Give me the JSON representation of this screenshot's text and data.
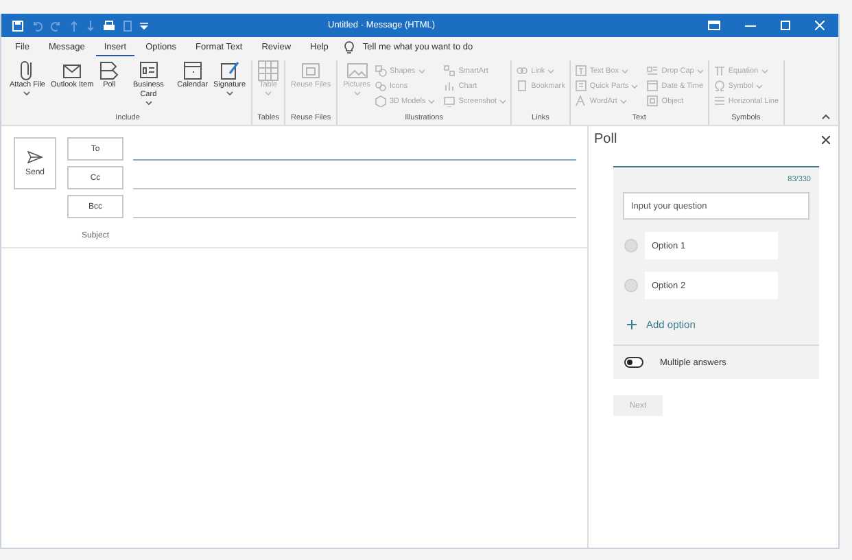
{
  "window": {
    "title": "Untitled  -  Message (HTML)"
  },
  "menu_tabs": [
    {
      "label": "File",
      "selected": false
    },
    {
      "label": "Message",
      "selected": false
    },
    {
      "label": "Insert",
      "selected": true
    },
    {
      "label": "Options",
      "selected": false
    },
    {
      "label": "Format Text",
      "selected": false
    },
    {
      "label": "Review",
      "selected": false
    },
    {
      "label": "Help",
      "selected": false
    }
  ],
  "tell_me": "Tell me what you want to do",
  "ribbon_groups": [
    {
      "label": "Include",
      "items": [
        {
          "kind": "large",
          "label": "Attach File",
          "dropdown": true,
          "disabled": false
        },
        {
          "kind": "large",
          "label": "Outlook Item",
          "dropdown": false,
          "disabled": false
        },
        {
          "kind": "large",
          "label": "Poll",
          "dropdown": false,
          "disabled": false
        },
        {
          "kind": "large",
          "label": "Business Card",
          "dropdown": true,
          "disabled": false
        },
        {
          "kind": "large",
          "label": "Calendar",
          "dropdown": false,
          "disabled": false
        },
        {
          "kind": "large",
          "label": "Signature",
          "dropdown": true,
          "disabled": false
        }
      ]
    },
    {
      "label": "Tables",
      "items": [
        {
          "kind": "large",
          "label": "Table",
          "dropdown": true,
          "disabled": true
        }
      ]
    },
    {
      "label": "Reuse Files",
      "items": [
        {
          "kind": "large",
          "label": "Reuse Files",
          "dropdown": false,
          "disabled": true
        }
      ]
    },
    {
      "label": "Illustrations",
      "items": [
        {
          "kind": "large",
          "label": "Pictures",
          "dropdown": true,
          "disabled": true
        },
        {
          "kind": "small",
          "label": "Shapes",
          "dropdown": true,
          "disabled": true
        },
        {
          "kind": "small",
          "label": "Icons",
          "dropdown": false,
          "disabled": true
        },
        {
          "kind": "small",
          "label": "3D Models",
          "dropdown": true,
          "disabled": true
        },
        {
          "kind": "small",
          "label": "SmartArt",
          "dropdown": false,
          "disabled": true
        },
        {
          "kind": "small",
          "label": "Chart",
          "dropdown": false,
          "disabled": true
        },
        {
          "kind": "small",
          "label": "Screenshot",
          "dropdown": true,
          "disabled": true
        }
      ]
    },
    {
      "label": "Links",
      "items": [
        {
          "kind": "small",
          "label": "Link",
          "dropdown": true,
          "disabled": true
        },
        {
          "kind": "small",
          "label": "Bookmark",
          "dropdown": false,
          "disabled": true
        }
      ]
    },
    {
      "label": "Text",
      "items": [
        {
          "kind": "small",
          "label": "Text Box",
          "dropdown": true,
          "disabled": true
        },
        {
          "kind": "small",
          "label": "Quick Parts",
          "dropdown": true,
          "disabled": true
        },
        {
          "kind": "small",
          "label": "WordArt",
          "dropdown": true,
          "disabled": true
        },
        {
          "kind": "small",
          "label": "Drop Cap",
          "dropdown": true,
          "disabled": true
        },
        {
          "kind": "small",
          "label": "Date & Time",
          "dropdown": false,
          "disabled": true
        },
        {
          "kind": "small",
          "label": "Object",
          "dropdown": false,
          "disabled": true
        }
      ]
    },
    {
      "label": "Symbols",
      "items": [
        {
          "kind": "small",
          "label": "Equation",
          "dropdown": true,
          "disabled": true
        },
        {
          "kind": "small",
          "label": "Symbol",
          "dropdown": true,
          "disabled": true
        },
        {
          "kind": "small",
          "label": "Horizontal Line",
          "dropdown": false,
          "disabled": true
        }
      ]
    }
  ],
  "compose": {
    "send": "Send",
    "address_buttons": [
      "To",
      "Cc",
      "Bcc"
    ],
    "subject_label": "Subject"
  },
  "poll": {
    "title": "Poll",
    "counter": "83/330",
    "question_placeholder": "Input your question",
    "options": [
      {
        "placeholder": "Option 1",
        "selected": false
      },
      {
        "placeholder": "Option 2",
        "selected": false
      }
    ],
    "add_option": "Add option",
    "multiple_answers": {
      "label": "Multiple answers",
      "on": false
    },
    "next": {
      "label": "Next",
      "disabled": true
    }
  }
}
